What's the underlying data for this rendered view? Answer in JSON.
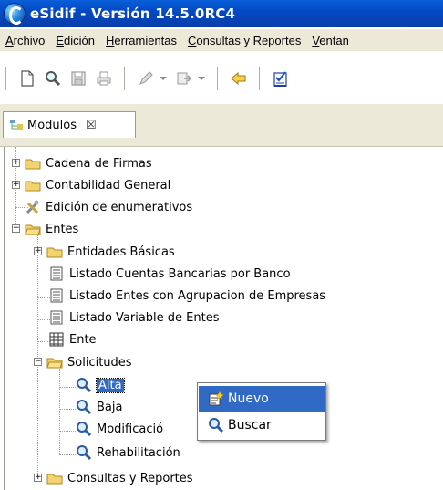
{
  "window": {
    "title": "eSidif - Versión 14.5.0RC4"
  },
  "menubar": {
    "items": [
      {
        "first": "A",
        "rest": "rchivo"
      },
      {
        "first": "E",
        "rest": "dición"
      },
      {
        "first": "H",
        "rest": "erramientas"
      },
      {
        "first": "C",
        "rest": "onsultas y Reportes"
      },
      {
        "first": "V",
        "rest": "entan"
      }
    ]
  },
  "view_tab": {
    "label": "Modulos",
    "close": "☒"
  },
  "tree": {
    "nodes": [
      {
        "label": "Cadena de Firmas"
      },
      {
        "label": "Contabilidad General"
      },
      {
        "label": "Edición de enumerativos"
      },
      {
        "label": "Entes"
      },
      {
        "label": "Entidades Básicas"
      },
      {
        "label": "Listado Cuentas Bancarias por Banco"
      },
      {
        "label": "Listado Entes con Agrupacion de Empresas"
      },
      {
        "label": "Listado Variable de Entes"
      },
      {
        "label": "Ente"
      },
      {
        "label": "Solicitudes"
      },
      {
        "label": "Alta"
      },
      {
        "label": "Baja"
      },
      {
        "label": "Modificació"
      },
      {
        "label": "Rehabilitación"
      },
      {
        "label": "Consultas y Reportes"
      }
    ]
  },
  "context_menu": {
    "items": [
      {
        "label": "Nuevo"
      },
      {
        "label": "Buscar"
      }
    ]
  },
  "colors": {
    "titlebar": "#0349c5",
    "selection": "#316ac5",
    "chrome": "#ece9d8"
  }
}
